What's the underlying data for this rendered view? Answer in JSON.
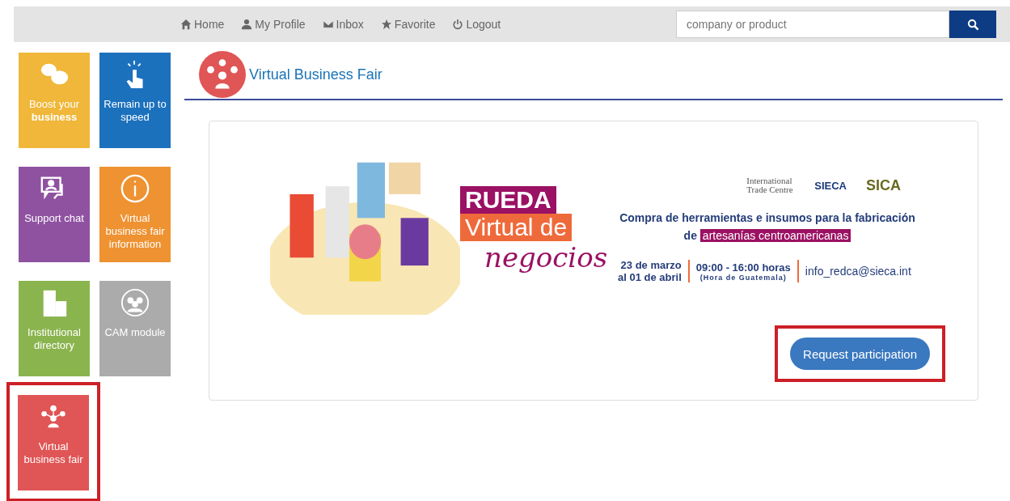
{
  "nav": {
    "items": [
      {
        "label": "Home",
        "kind": "home"
      },
      {
        "label": "My Profile",
        "kind": "user"
      },
      {
        "label": "Inbox",
        "kind": "mail"
      },
      {
        "label": "Favorite",
        "kind": "star"
      },
      {
        "label": "Logout",
        "kind": "power"
      }
    ],
    "search": {
      "placeholder": "company or product"
    }
  },
  "tiles": [
    {
      "label": "Boost your **business**",
      "kind": "chat",
      "color": "#f0b73a",
      "selected": false
    },
    {
      "label": "Remain up to speed",
      "kind": "tap",
      "color": "#1c71bd",
      "selected": false
    },
    {
      "label": "Support chat",
      "kind": "support",
      "color": "#8f52a1",
      "selected": false
    },
    {
      "label": "Virtual business fair information",
      "kind": "info",
      "color": "#ee9232",
      "selected": false
    },
    {
      "label": "Institutional directory",
      "kind": "building",
      "color": "#8ab44e",
      "selected": false
    },
    {
      "label": "CAM module",
      "kind": "people",
      "color": "#ababab",
      "selected": false
    },
    {
      "label": "Virtual business fair",
      "kind": "fair",
      "color": "#e05555",
      "selected": true
    }
  ],
  "page": {
    "title": "Virtual Business Fair"
  },
  "banner": {
    "headline": [
      "RUEDA",
      "Virtual de",
      "negocios"
    ],
    "logos": [
      "International Trade Centre",
      "SIECA",
      "SICA"
    ],
    "subtitle": "Compra de herramientas e insumos para la fabricación de",
    "highlight": "artesanías centroamericanas",
    "dates": [
      "23 de marzo",
      "al 01 de abril"
    ],
    "hours": "09:00 - 16:00 horas",
    "timezone": "(Hora de Guatemala)",
    "email": "info_redca@sieca.int"
  },
  "action": {
    "label": "Request participation",
    "highlighted": true
  }
}
